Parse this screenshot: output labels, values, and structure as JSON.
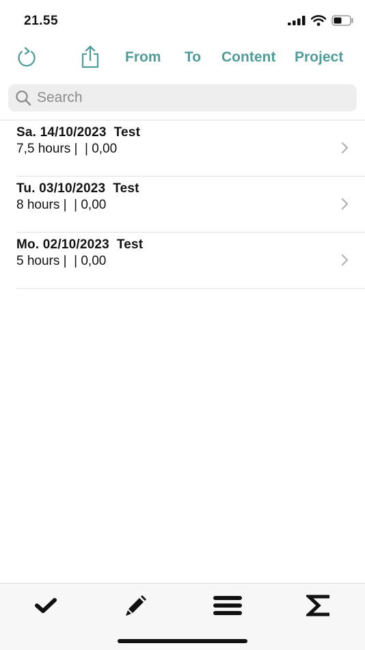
{
  "status_bar": {
    "time": "21.55"
  },
  "toolbar": {
    "from_label": "From",
    "to_label": "To",
    "content_label": "Content",
    "project_label": "Project"
  },
  "search": {
    "placeholder": "Search",
    "value": ""
  },
  "entries": [
    {
      "title": "Sa. 14/10/2023  Test",
      "subtitle": "7,5 hours |  | 0,00"
    },
    {
      "title": "Tu. 03/10/2023  Test",
      "subtitle": "8 hours |  | 0,00"
    },
    {
      "title": "Mo. 02/10/2023  Test",
      "subtitle": "5 hours |  | 0,00"
    }
  ],
  "tabs": [
    "checkmark-icon",
    "pencil-icon",
    "list-icon",
    "sigma-icon"
  ],
  "colors": {
    "accent": "#4f9c98",
    "text": "#111111",
    "separator": "#e2e2e4"
  }
}
